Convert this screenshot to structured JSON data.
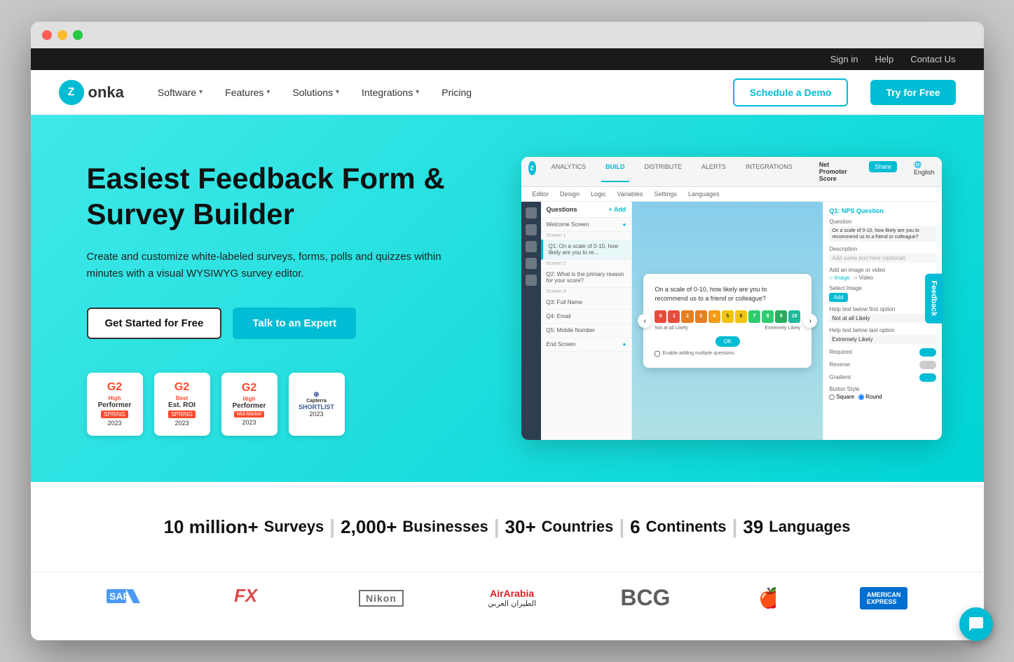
{
  "browser": {
    "dots": [
      "red",
      "yellow",
      "green"
    ]
  },
  "topbar": {
    "signin": "Sign in",
    "help": "Help",
    "contact": "Contact Us"
  },
  "navbar": {
    "logo_letter": "Z",
    "logo_text": "onka",
    "items": [
      {
        "label": "Software",
        "has_chevron": true
      },
      {
        "label": "Features",
        "has_chevron": true
      },
      {
        "label": "Solutions",
        "has_chevron": true
      },
      {
        "label": "Integrations",
        "has_chevron": true
      },
      {
        "label": "Pricing",
        "has_chevron": false
      }
    ],
    "schedule_btn": "Schedule a Demo",
    "try_btn": "Try for Free"
  },
  "hero": {
    "title": "Easiest Feedback Form & Survey Builder",
    "description": "Create and customize white-labeled surveys, forms, polls and quizzes within minutes with a visual WYSIWYG survey editor.",
    "btn_primary": "Get Started for Free",
    "btn_secondary": "Talk to an Expert",
    "badges": [
      {
        "type": "g2",
        "title": "High Performer",
        "sub": "SPRING",
        "year": "2023"
      },
      {
        "type": "g2",
        "title": "Best Est. ROI",
        "sub": "SPRING",
        "year": "2023"
      },
      {
        "type": "g2",
        "title": "High Performer",
        "sub": "Mid-Market SPRING",
        "year": "2023"
      },
      {
        "type": "capterra",
        "title": "SHORTLIST",
        "year": "2023"
      }
    ]
  },
  "app_mockup": {
    "tabs": [
      "ANALYTICS",
      "BUILD",
      "DISTRIBUTE",
      "ALERTS",
      "INTEGRATIONS"
    ],
    "active_tab": "BUILD",
    "subtabs": [
      "Editor",
      "Design",
      "Logic",
      "Variables",
      "Settings",
      "Languages"
    ],
    "questions": [
      "Welcome Screen",
      "Q1: On a scale of 0-10, how likely are you to re...",
      "Q2: What is the primary reason for your score?",
      "Q3: Full Name",
      "Q4: Email",
      "Q5: Mobile Number",
      "End Screen"
    ],
    "nps_question": "On a scale of 0-10, how likely are you to recommend us to a friend or colleague?",
    "nps_labels": [
      "Not at all Likely",
      "Extremely Likely"
    ],
    "nps_colors": [
      "#e74c3c",
      "#e74c3c",
      "#e67e22",
      "#e67e22",
      "#f39c12",
      "#f1c40f",
      "#f1c40f",
      "#2ecc71",
      "#2ecc71",
      "#27ae60",
      "#1abc9c"
    ],
    "settings_title": "Q1: NPS Question",
    "settings_fields": [
      {
        "label": "Question",
        "value": "On a scale of 0-10, how likely are you to recommend us to a friend or colleague?"
      },
      {
        "label": "Description",
        "value": "Add some text here (optional)"
      },
      {
        "label": "Help text below first option",
        "value": "Not at all Likely"
      },
      {
        "label": "Help text below last option",
        "value": "Extremely Likely"
      }
    ]
  },
  "stats": {
    "items": [
      {
        "number": "10 million+",
        "label": "Surveys"
      },
      {
        "number": "2,000+",
        "label": "Businesses"
      },
      {
        "number": "30+",
        "label": "Countries"
      },
      {
        "number": "6",
        "label": "Continents"
      },
      {
        "number": "39",
        "label": "Languages"
      }
    ],
    "divider": "|"
  },
  "brands": [
    "SAP",
    "FX",
    "Nikon",
    "AirArabia",
    "BCG",
    "Apple",
    "AmericanExpress"
  ],
  "feedback_tab": "Feedback",
  "chat_btn": "💬"
}
